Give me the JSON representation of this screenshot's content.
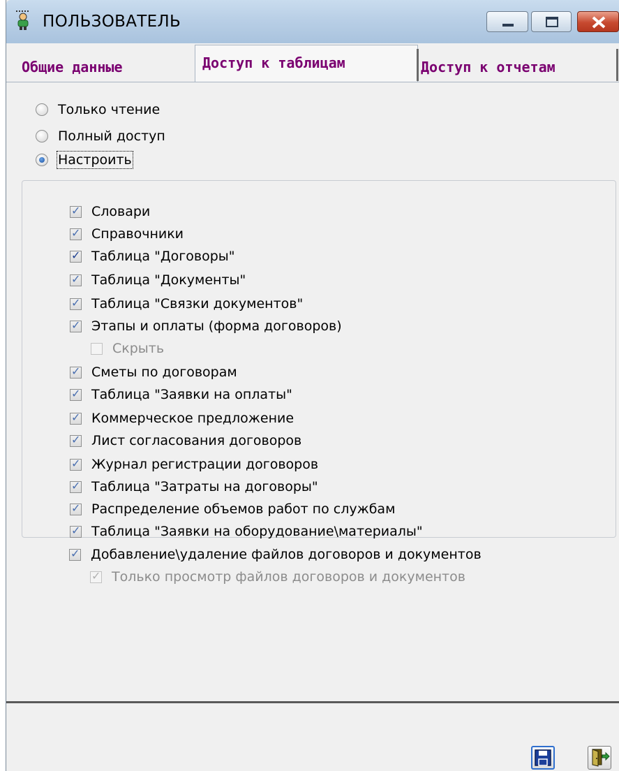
{
  "window": {
    "title": "ПОЛЬЗОВАТЕЛЬ"
  },
  "tabs": [
    {
      "label": "Общие данные",
      "active": false
    },
    {
      "label": "Доступ к таблицам",
      "active": true
    },
    {
      "label": "Доступ к отчетам",
      "active": false
    }
  ],
  "access_mode": {
    "options": [
      {
        "label": "Только чтение",
        "selected": false
      },
      {
        "label": "Полный доступ",
        "selected": false
      },
      {
        "label": "Настроить",
        "selected": true
      }
    ]
  },
  "permissions": [
    {
      "label": "Словари",
      "checked": true
    },
    {
      "label": "Справочники",
      "checked": true
    },
    {
      "label": "Таблица \"Договоры\"",
      "checked": true
    },
    {
      "label": "Таблица \"Документы\"",
      "checked": true
    },
    {
      "label": "Таблица \"Связки документов\"",
      "checked": true
    },
    {
      "label": "Этапы и оплаты (форма договоров)",
      "checked": true
    },
    {
      "label": "Скрыть",
      "checked": false,
      "disabled": true
    },
    {
      "label": "Сметы по договорам",
      "checked": true
    },
    {
      "label": "Таблица \"Заявки на оплаты\"",
      "checked": true
    },
    {
      "label": "Коммерческое предложение",
      "checked": true
    },
    {
      "label": "Лист согласования договоров",
      "checked": true
    },
    {
      "label": "Журнал регистрации договоров",
      "checked": true
    },
    {
      "label": "Таблица \"Затраты на договоры\"",
      "checked": true
    },
    {
      "label": "Распределение объемов работ по службам",
      "checked": true
    },
    {
      "label": "Таблица \"Заявки на оборудование\\материалы\"",
      "checked": true
    },
    {
      "label": "Добавление\\удаление файлов договоров и документов",
      "checked": true
    },
    {
      "label": "Только просмотр файлов договоров и документов",
      "checked": true,
      "disabled": true
    }
  ],
  "icons": {
    "title": "user-icon",
    "minimize": "minimize-icon",
    "maximize": "maximize-icon",
    "close": "close-icon",
    "save": "save-icon",
    "exit": "exit-door-icon"
  },
  "colors": {
    "tab_text": "#7a0070",
    "titlebar": "#b9cfe6",
    "close_button": "#c74a30",
    "save_focus": "#2f6fce"
  }
}
